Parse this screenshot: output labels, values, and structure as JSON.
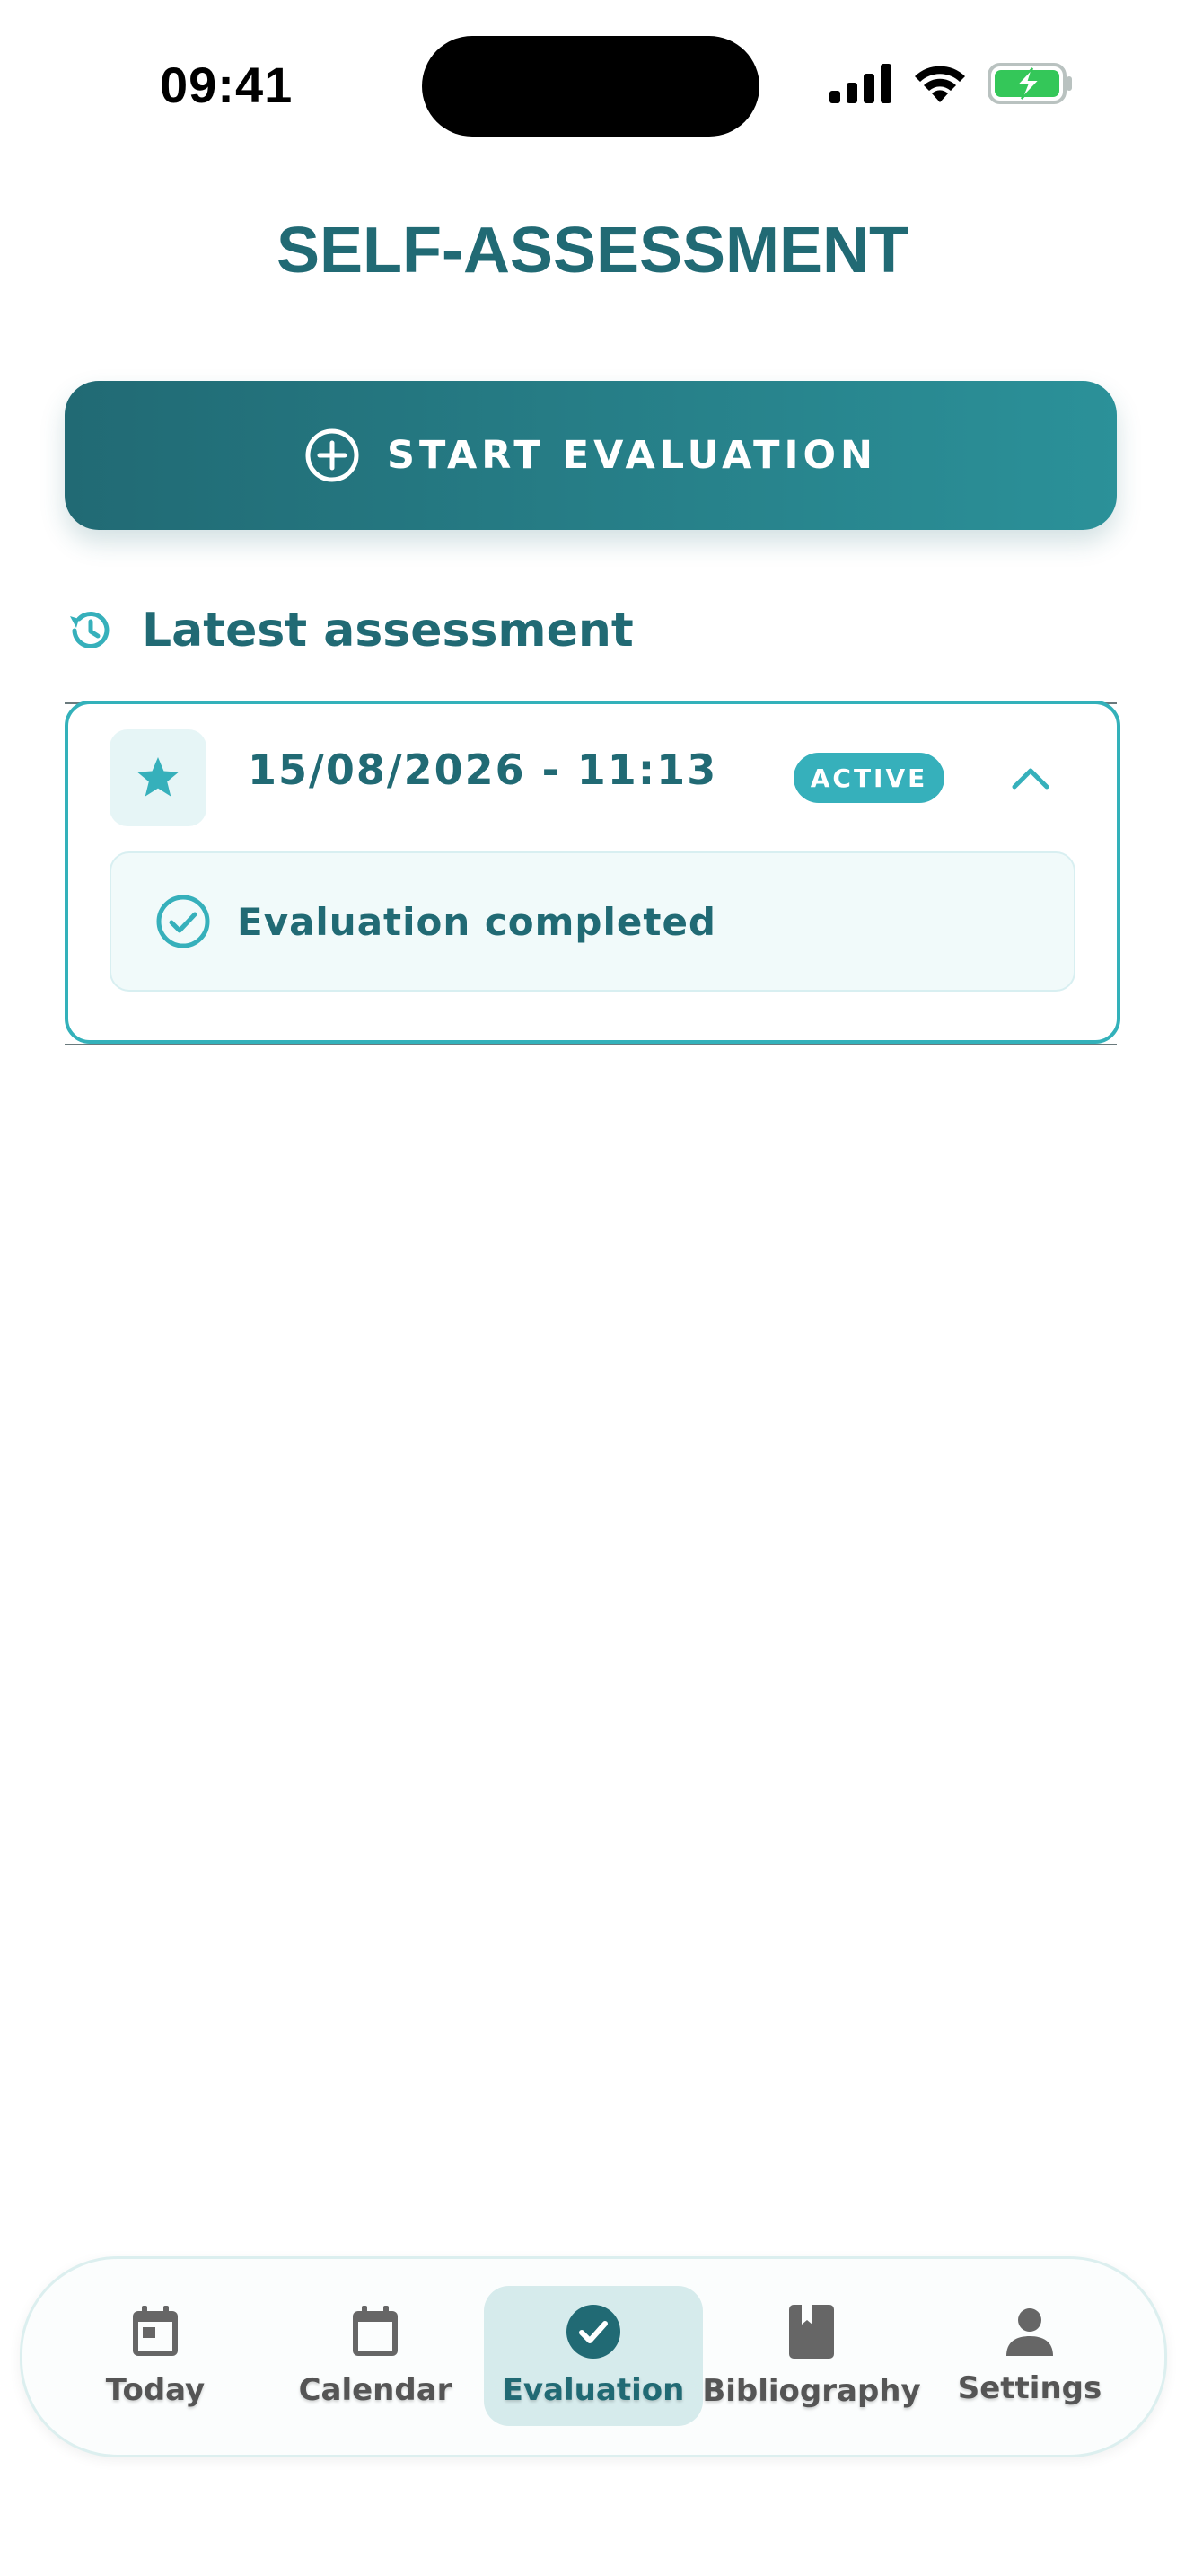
{
  "status_bar": {
    "time": "09:41"
  },
  "header": {
    "title": "SELF-ASSESSMENT"
  },
  "actions": {
    "start_label": "START EVALUATION"
  },
  "latest": {
    "section_title": "Latest assessment",
    "card": {
      "date": "15/08/2026 - 11:13",
      "badge": "ACTIVE",
      "status_text": "Evaluation completed"
    }
  },
  "tabs": [
    {
      "label": "Today",
      "icon": "calendar-today-icon"
    },
    {
      "label": "Calendar",
      "icon": "calendar-icon"
    },
    {
      "label": "Evaluation",
      "icon": "check-circle-icon",
      "active": true
    },
    {
      "label": "Bibliography",
      "icon": "book-icon"
    },
    {
      "label": "Settings",
      "icon": "person-icon"
    }
  ],
  "colors": {
    "primary": "#216a74",
    "accent": "#36b0bb",
    "battery": "#34c759"
  }
}
